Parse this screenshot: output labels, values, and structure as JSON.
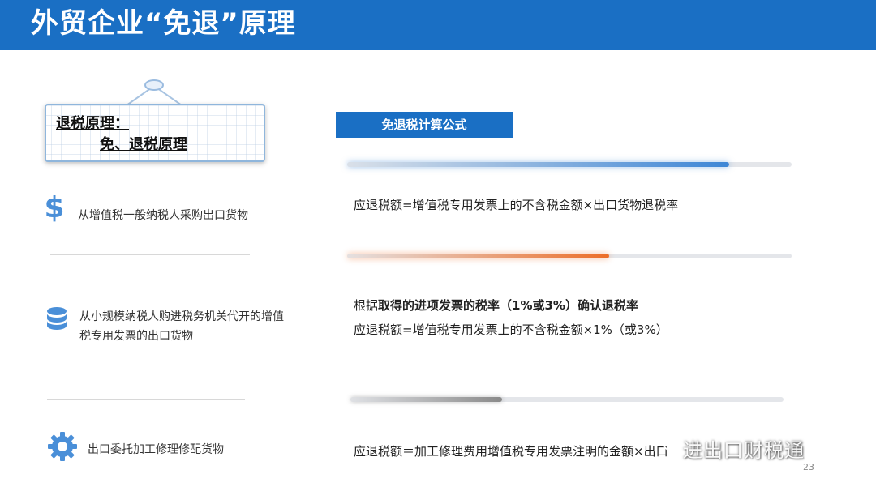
{
  "header": {
    "title": "外贸企业“免退”原理"
  },
  "sign": {
    "line1": "退税原理：",
    "line2": "免、退税原理"
  },
  "left_items": [
    {
      "icon": "dollar-icon",
      "lines": [
        "从增值税一般纳税人采购出口货物"
      ]
    },
    {
      "icon": "database-icon",
      "lines": [
        "从小规模纳税人购进税务机关代开的增值",
        "税专用发票的出口货物"
      ]
    },
    {
      "icon": "gear-icon",
      "lines": [
        "出口委托加工修理修配货物"
      ]
    }
  ],
  "formula_tag": "免退税计算公式",
  "progress": [
    {
      "color": "#3d86d6",
      "level": 0.86
    },
    {
      "color": "#ec6e28",
      "level": 0.59
    },
    {
      "color": "#8a8a8a",
      "level": 0.35
    }
  ],
  "formulas": {
    "f1": "应退税额=增值税专用发票上的不含税金额×出口货物退税率",
    "f2_prefix": "根据",
    "f2_bold": "取得的进项发票的税率（1%或3%）确认退税率",
    "f2_line2": "应退税额=增值税专用发票上的不含税金额×1%（或3%）",
    "f3": "应退税额＝加工修理费用增值税专用发票注明的金额×出口"
  },
  "watermark": "进出口财税通",
  "page_number": "23",
  "colors": {
    "accent": "#1a6fc4",
    "icon_blue": "#4a8fd8"
  }
}
